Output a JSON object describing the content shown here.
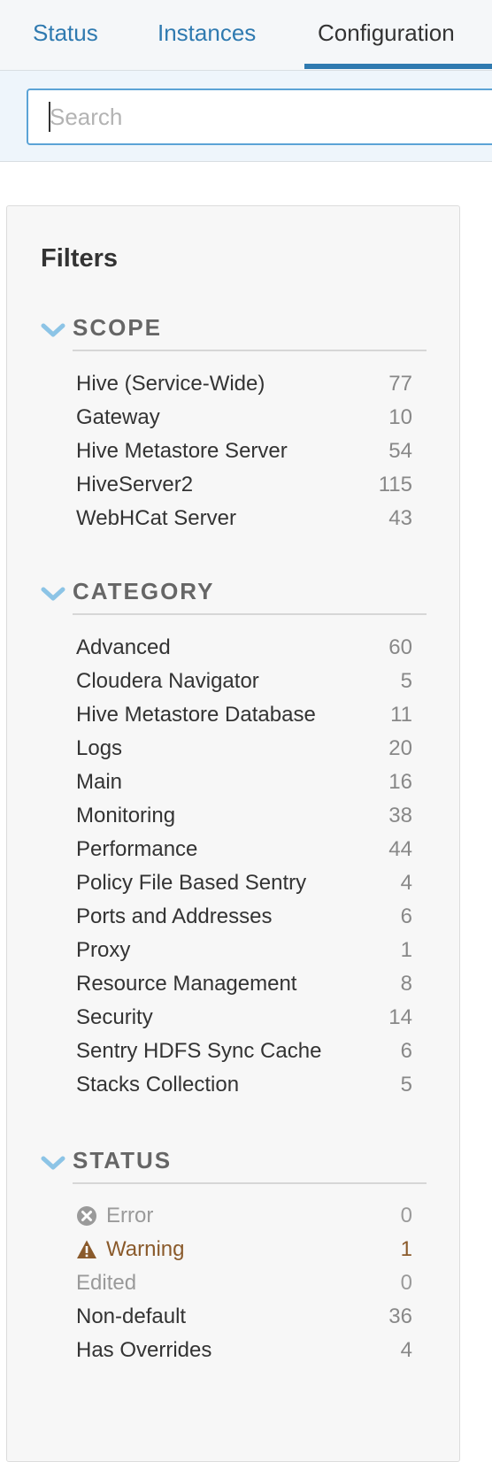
{
  "tabs": [
    {
      "label": "Status"
    },
    {
      "label": "Instances"
    },
    {
      "label": "Configuration"
    }
  ],
  "search": {
    "placeholder": "Search",
    "value": ""
  },
  "filters": {
    "title": "Filters",
    "scope": {
      "label": "SCOPE",
      "items": [
        {
          "label": "Hive (Service-Wide)",
          "count": "77"
        },
        {
          "label": "Gateway",
          "count": "10"
        },
        {
          "label": "Hive Metastore Server",
          "count": "54"
        },
        {
          "label": "HiveServer2",
          "count": "115"
        },
        {
          "label": "WebHCat Server",
          "count": "43"
        }
      ]
    },
    "category": {
      "label": "CATEGORY",
      "items": [
        {
          "label": "Advanced",
          "count": "60"
        },
        {
          "label": "Cloudera Navigator",
          "count": "5"
        },
        {
          "label": "Hive Metastore Database",
          "count": "11"
        },
        {
          "label": "Logs",
          "count": "20"
        },
        {
          "label": "Main",
          "count": "16"
        },
        {
          "label": "Monitoring",
          "count": "38"
        },
        {
          "label": "Performance",
          "count": "44"
        },
        {
          "label": "Policy File Based Sentry",
          "count": "4"
        },
        {
          "label": "Ports and Addresses",
          "count": "6"
        },
        {
          "label": "Proxy",
          "count": "1"
        },
        {
          "label": "Resource Management",
          "count": "8"
        },
        {
          "label": "Security",
          "count": "14"
        },
        {
          "label": "Sentry HDFS Sync Cache",
          "count": "6"
        },
        {
          "label": "Stacks Collection",
          "count": "5"
        }
      ]
    },
    "status": {
      "label": "STATUS",
      "items": [
        {
          "label": "Error",
          "count": "0",
          "icon": "error-circle-icon"
        },
        {
          "label": "Warning",
          "count": "1",
          "icon": "warning-triangle-icon"
        },
        {
          "label": "Edited",
          "count": "0"
        },
        {
          "label": "Non-default",
          "count": "36"
        },
        {
          "label": "Has Overrides",
          "count": "4"
        }
      ]
    }
  },
  "colors": {
    "accent": "#2f7ab0",
    "chevron": "#8cc4e6",
    "warning": "#8a5a2b"
  }
}
